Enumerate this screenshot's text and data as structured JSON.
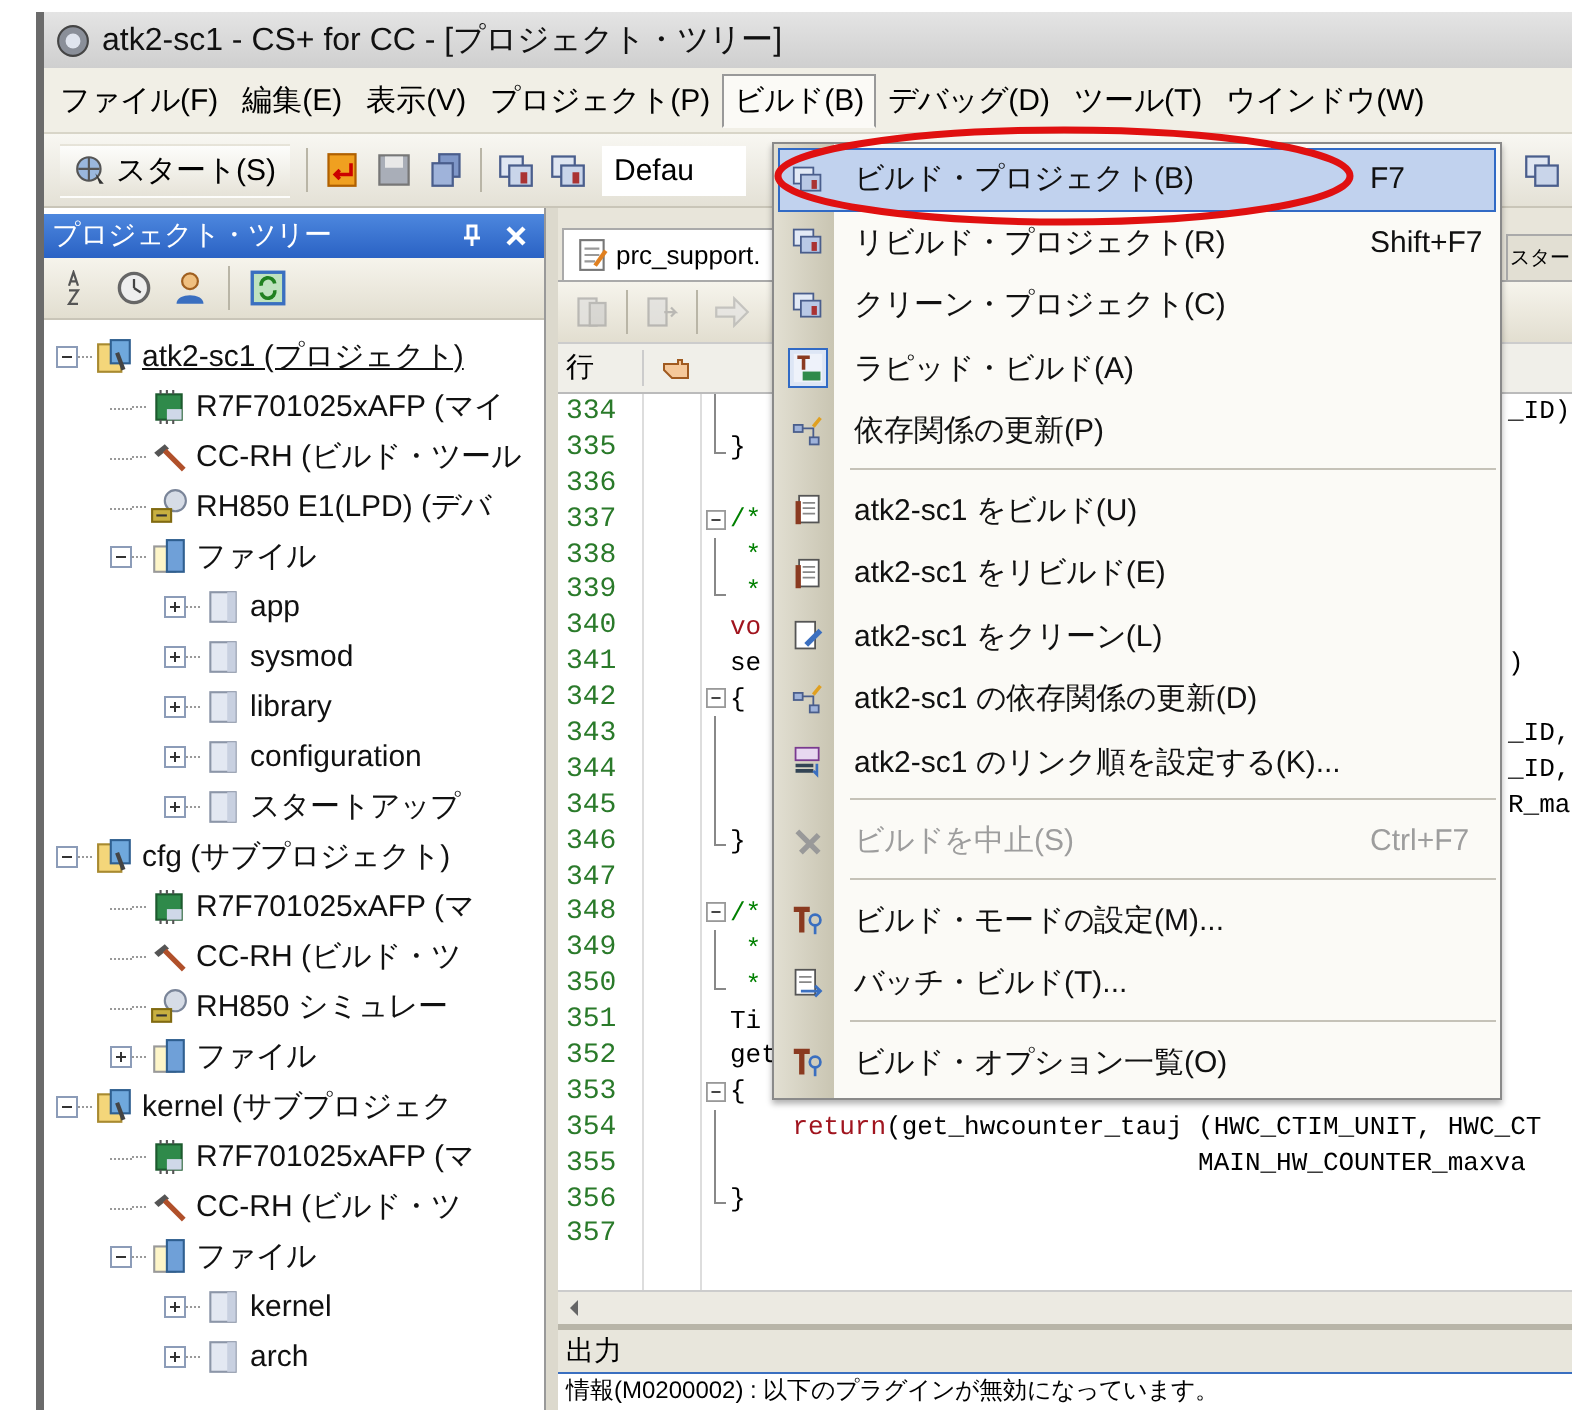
{
  "window": {
    "title": "atk2-sc1 - CS+ for CC - [プロジェクト・ツリー]"
  },
  "menu_bar": [
    {
      "label": "ファイル(F)",
      "selected": false
    },
    {
      "label": "編集(E)",
      "selected": false
    },
    {
      "label": "表示(V)",
      "selected": false
    },
    {
      "label": "プロジェクト(P)",
      "selected": false
    },
    {
      "label": "ビルド(B)",
      "selected": true
    },
    {
      "label": "デバッグ(D)",
      "selected": false
    },
    {
      "label": "ツール(T)",
      "selected": false
    },
    {
      "label": "ウインドウ(W)",
      "selected": false
    }
  ],
  "toolbar": {
    "start_button": "スタート(S)",
    "config_combo": "Defau"
  },
  "project_tree": {
    "title": "プロジェクト・ツリー",
    "nodes": [
      {
        "kind": "project",
        "label": "atk2-sc1 (プロジェクト)",
        "active": true,
        "expanded": true,
        "children": [
          {
            "kind": "device",
            "label": "R7F701025xAFP (マイ"
          },
          {
            "kind": "build_tool",
            "label": "CC-RH (ビルド・ツール"
          },
          {
            "kind": "debug_tool",
            "label": "RH850 E1(LPD) (デバ"
          },
          {
            "kind": "files",
            "label": "ファイル",
            "expanded": true,
            "children": [
              {
                "kind": "folder",
                "label": "app",
                "expanded": false
              },
              {
                "kind": "folder",
                "label": "sysmod",
                "expanded": false
              },
              {
                "kind": "folder",
                "label": "library",
                "expanded": false
              },
              {
                "kind": "folder",
                "label": "configuration",
                "expanded": false
              },
              {
                "kind": "folder",
                "label": "スタートアップ",
                "expanded": false
              }
            ]
          }
        ]
      },
      {
        "kind": "project",
        "label": "cfg (サブプロジェクト)",
        "active": false,
        "expanded": true,
        "children": [
          {
            "kind": "device",
            "label": "R7F701025xAFP (マ"
          },
          {
            "kind": "build_tool",
            "label": "CC-RH (ビルド・ツ"
          },
          {
            "kind": "debug_tool",
            "label": "RH850 シミュレー"
          },
          {
            "kind": "files",
            "label": "ファイル",
            "expanded": false
          }
        ]
      },
      {
        "kind": "project",
        "label": "kernel (サブプロジェク",
        "active": false,
        "expanded": true,
        "children": [
          {
            "kind": "device",
            "label": "R7F701025xAFP (マ"
          },
          {
            "kind": "build_tool",
            "label": "CC-RH (ビルド・ツ"
          },
          {
            "kind": "files",
            "label": "ファイル",
            "expanded": true,
            "children": [
              {
                "kind": "folder",
                "label": "kernel",
                "expanded": false
              },
              {
                "kind": "folder",
                "label": "arch",
                "expanded": false
              }
            ]
          }
        ]
      }
    ]
  },
  "editor": {
    "tabs": [
      {
        "label": "prc_support.",
        "selected": true
      },
      {
        "label": "スター",
        "selected": false
      }
    ],
    "line_header": "行",
    "lines": [
      {
        "num": "334",
        "kind": "inner",
        "right": "_ID)"
      },
      {
        "num": "335",
        "kind": "close",
        "tokens": [
          {
            "text": "}",
            "kind": "plain"
          }
        ]
      },
      {
        "num": "336",
        "kind": "plain"
      },
      {
        "num": "337",
        "kind": "open",
        "tokens": [
          {
            "text": "/*",
            "kind": "comment"
          }
        ]
      },
      {
        "num": "338",
        "kind": "inner",
        "tokens": [
          {
            "text": " *",
            "kind": "comment"
          }
        ]
      },
      {
        "num": "339",
        "kind": "close",
        "tokens": [
          {
            "text": " *",
            "kind": "comment"
          }
        ]
      },
      {
        "num": "340",
        "kind": "plain",
        "tokens": [
          {
            "text": "vo",
            "kind": "keyword"
          }
        ]
      },
      {
        "num": "341",
        "kind": "plain",
        "tokens": [
          {
            "text": "se",
            "kind": "plain"
          }
        ],
        "right": ")"
      },
      {
        "num": "342",
        "kind": "open",
        "tokens": [
          {
            "text": "{",
            "kind": "plain"
          }
        ]
      },
      {
        "num": "343",
        "kind": "inner",
        "right": "_ID,"
      },
      {
        "num": "344",
        "kind": "inner",
        "right": "_ID,"
      },
      {
        "num": "345",
        "kind": "inner",
        "right": "R_ma"
      },
      {
        "num": "346",
        "kind": "close",
        "tokens": [
          {
            "text": "}",
            "kind": "plain"
          }
        ]
      },
      {
        "num": "347",
        "kind": "plain"
      },
      {
        "num": "348",
        "kind": "open",
        "tokens": [
          {
            "text": "/*",
            "kind": "comment"
          }
        ]
      },
      {
        "num": "349",
        "kind": "inner",
        "tokens": [
          {
            "text": " *",
            "kind": "comment"
          }
        ]
      },
      {
        "num": "350",
        "kind": "close",
        "tokens": [
          {
            "text": " *",
            "kind": "comment"
          }
        ]
      },
      {
        "num": "351",
        "kind": "plain",
        "tokens": [
          {
            "text": "Ti",
            "kind": "plain"
          }
        ]
      },
      {
        "num": "352",
        "kind": "plain",
        "tokens": [
          {
            "text": "get",
            "kind": "plain"
          }
        ]
      },
      {
        "num": "353",
        "kind": "open",
        "tokens": [
          {
            "text": "{",
            "kind": "plain"
          }
        ]
      },
      {
        "num": "354",
        "kind": "inner",
        "tokens": [
          {
            "text": "    return",
            "kind": "keyword"
          },
          {
            "text": "(get_hwcounter_tauj (HWC_CTIM_UNIT, HWC_CT",
            "kind": "plain"
          }
        ]
      },
      {
        "num": "355",
        "kind": "inner",
        "tokens": [
          {
            "text": "                              MAIN_HW_COUNTER_maxva",
            "kind": "plain"
          }
        ]
      },
      {
        "num": "356",
        "kind": "close",
        "tokens": [
          {
            "text": "}",
            "kind": "plain"
          }
        ]
      },
      {
        "num": "357",
        "kind": "plain"
      }
    ]
  },
  "output": {
    "title": "出力",
    "message": "情報(M0200002) : 以下のプラグインが無効になっています。"
  },
  "build_menu": {
    "items": [
      {
        "kind": "item",
        "label": "ビルド・プロジェクト(B)",
        "shortcut": "F7",
        "selected": true,
        "checked": false,
        "disabled": false
      },
      {
        "kind": "item",
        "label": "リビルド・プロジェクト(R)",
        "shortcut": "Shift+F7",
        "selected": false,
        "checked": false,
        "disabled": false
      },
      {
        "kind": "item",
        "label": "クリーン・プロジェクト(C)",
        "selected": false,
        "checked": false,
        "disabled": false
      },
      {
        "kind": "item",
        "label": "ラピッド・ビルド(A)",
        "selected": false,
        "checked": true,
        "disabled": false
      },
      {
        "kind": "item",
        "label": "依存関係の更新(P)",
        "selected": false,
        "checked": false,
        "disabled": false
      },
      {
        "kind": "separator"
      },
      {
        "kind": "item",
        "label": "atk2-sc1 をビルド(U)",
        "selected": false,
        "checked": false,
        "disabled": false
      },
      {
        "kind": "item",
        "label": "atk2-sc1 をリビルド(E)",
        "selected": false,
        "checked": false,
        "disabled": false
      },
      {
        "kind": "item",
        "label": "atk2-sc1 をクリーン(L)",
        "selected": false,
        "checked": false,
        "disabled": false
      },
      {
        "kind": "item",
        "label": "atk2-sc1 の依存関係の更新(D)",
        "selected": false,
        "checked": false,
        "disabled": false
      },
      {
        "kind": "item",
        "label": "atk2-sc1 のリンク順を設定する(K)...",
        "selected": false,
        "checked": false,
        "disabled": false
      },
      {
        "kind": "separator"
      },
      {
        "kind": "item",
        "label": "ビルドを中止(S)",
        "shortcut": "Ctrl+F7",
        "selected": false,
        "checked": false,
        "disabled": true
      },
      {
        "kind": "separator"
      },
      {
        "kind": "item",
        "label": "ビルド・モードの設定(M)...",
        "selected": false,
        "checked": false,
        "disabled": false
      },
      {
        "kind": "item",
        "label": "バッチ・ビルド(T)...",
        "selected": false,
        "checked": false,
        "disabled": false
      },
      {
        "kind": "separator"
      },
      {
        "kind": "item",
        "label": "ビルド・オプション一覧(O)",
        "selected": false,
        "checked": false,
        "disabled": false
      }
    ]
  }
}
